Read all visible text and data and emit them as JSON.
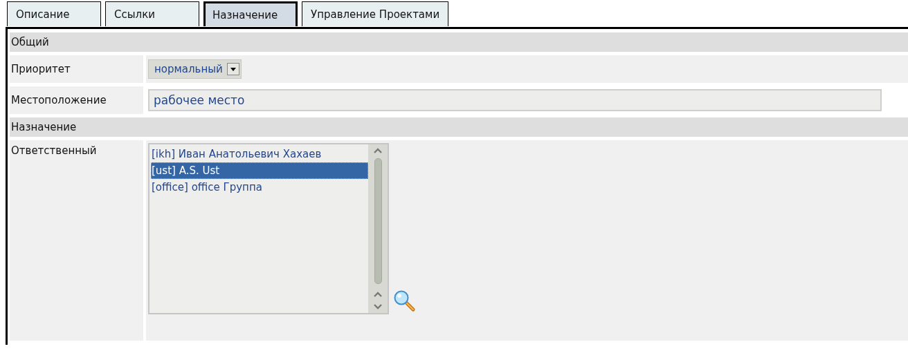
{
  "tabs": [
    {
      "label": "Описание",
      "selected": false
    },
    {
      "label": "Ссылки",
      "selected": false
    },
    {
      "label": "Назначение",
      "selected": true
    },
    {
      "label": "Управление Проектами",
      "selected": false
    }
  ],
  "sections": [
    {
      "title": "Общий",
      "rows": [
        {
          "kind": "select",
          "label": "Приоритет",
          "value": "нормальный"
        },
        {
          "kind": "text",
          "label": "Местоположение",
          "value": "рабочее место"
        }
      ]
    },
    {
      "title": "Назначение",
      "rows": [
        {
          "kind": "listbox",
          "label": "Ответственный",
          "options": [
            {
              "label": "[ikh] Иван Анатольевич Хахаев",
              "selected": false
            },
            {
              "label": "[ust] A.S. Ust",
              "selected": true
            },
            {
              "label": "[office] office Группа",
              "selected": false
            }
          ]
        }
      ]
    }
  ]
}
